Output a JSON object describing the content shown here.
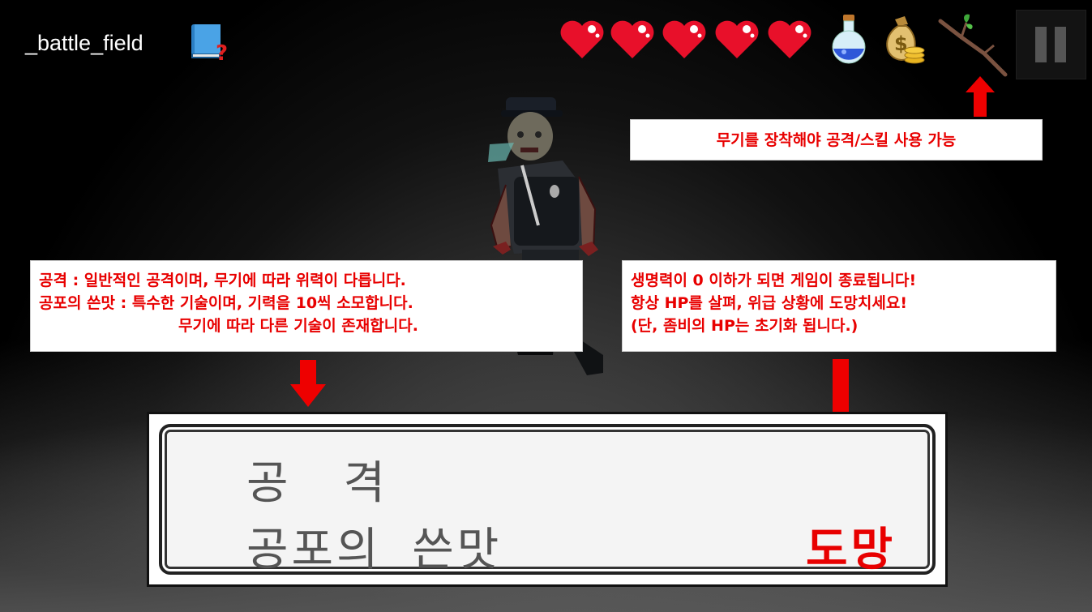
{
  "scene": {
    "title": "_battle_field"
  },
  "hud": {
    "hearts": 5,
    "icons": [
      "help-book-icon",
      "heart-icon",
      "potion-icon",
      "money-bag-icon",
      "stick-weapon-icon",
      "pause-icon"
    ]
  },
  "tips": {
    "weapon": "무기를 장착해야 공격/스킬 사용 가능",
    "skills": [
      "공격 : 일반적인 공격이며, 무기에 따라 위력이 다릅니다.",
      "공포의 쓴맛 : 특수한 기술이며, 기력을 10씩 소모합니다.",
      "무기에 따라 다른 기술이 존재합니다."
    ],
    "hp": [
      "생명력이 0 이하가 되면 게임이 종료됩니다!",
      "항상 HP를 살펴, 위급 상황에 도망치세요!",
      "(단, 좀비의 HP는 초기화 됩니다.)"
    ]
  },
  "menu": {
    "attack": "공격",
    "fear": "공포의 쓴맛",
    "flee": "도망"
  },
  "colors": {
    "tip_text": "#e80000",
    "arrow": "#ee0000",
    "menu_text": "#555555",
    "flee_text": "#e80000"
  }
}
